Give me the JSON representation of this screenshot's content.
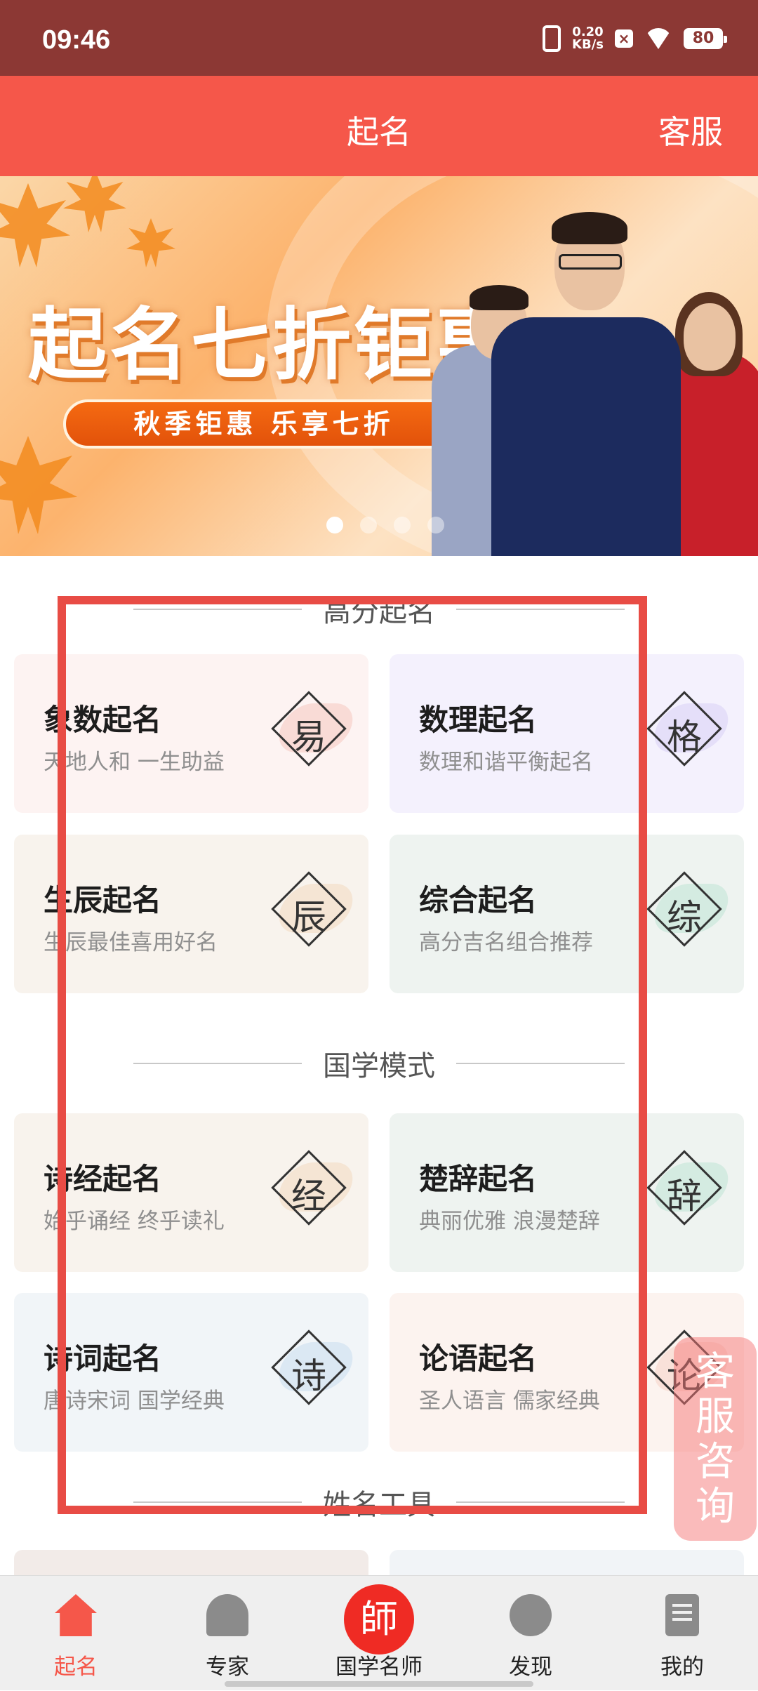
{
  "status_bar": {
    "time": "09:46",
    "net_speed_top": "0.20",
    "net_speed_unit": "KB/s",
    "battery": "80"
  },
  "header": {
    "title": "起名",
    "service_label": "客服"
  },
  "banner": {
    "headline": "起名七折钜惠",
    "pill_text": "秋季钜惠 乐享七折",
    "active_slide": 1,
    "slide_count": 4
  },
  "sections": {
    "high_score": {
      "title": "高分起名"
    },
    "guoxue": {
      "title": "国学模式"
    },
    "tools": {
      "title": "姓名工具"
    }
  },
  "cards": [
    {
      "title": "象数起名",
      "subtitle": "天地人和 一生助益",
      "badge": "易",
      "bg": "#fdf3f2",
      "accent": "#f6c7c0"
    },
    {
      "title": "数理起名",
      "subtitle": "数理和谐平衡起名",
      "badge": "格",
      "bg": "#f4f1fd",
      "accent": "#d9d0f5"
    },
    {
      "title": "生辰起名",
      "subtitle": "生辰最佳喜用好名",
      "badge": "辰",
      "bg": "#f8f3ed",
      "accent": "#f2d9bf"
    },
    {
      "title": "综合起名",
      "subtitle": "高分吉名组合推荐",
      "badge": "综",
      "bg": "#eef3f0",
      "accent": "#bfe4d6"
    },
    {
      "title": "诗经起名",
      "subtitle": "始乎诵经 终乎读礼",
      "badge": "经",
      "bg": "#f8f3ed",
      "accent": "#f2d9bf"
    },
    {
      "title": "楚辞起名",
      "subtitle": "典丽优雅 浪漫楚辞",
      "badge": "辞",
      "bg": "#eef3f0",
      "accent": "#bfe4d6"
    },
    {
      "title": "诗词起名",
      "subtitle": "唐诗宋词 国学经典",
      "badge": "诗",
      "bg": "#f1f5f8",
      "accent": "#c8dcee"
    },
    {
      "title": "论语起名",
      "subtitle": "圣人语言 儒家经典",
      "badge": "论",
      "bg": "#fcf3ef",
      "accent": "#f6d2c6"
    }
  ],
  "float_service": {
    "label": "客服咨询"
  },
  "tabbar": {
    "items": [
      {
        "label": "起名",
        "icon": "home-icon",
        "active": true
      },
      {
        "label": "专家",
        "icon": "expert-icon",
        "active": false
      },
      {
        "label": "国学名师",
        "icon": "master-icon",
        "glyph": "師",
        "active": false
      },
      {
        "label": "发现",
        "icon": "discover-icon",
        "active": false
      },
      {
        "label": "我的",
        "icon": "profile-icon",
        "active": false
      }
    ]
  },
  "colors": {
    "primary": "#f5574a",
    "status_bar": "#8c3834",
    "overlay_box": "#e84c45"
  }
}
